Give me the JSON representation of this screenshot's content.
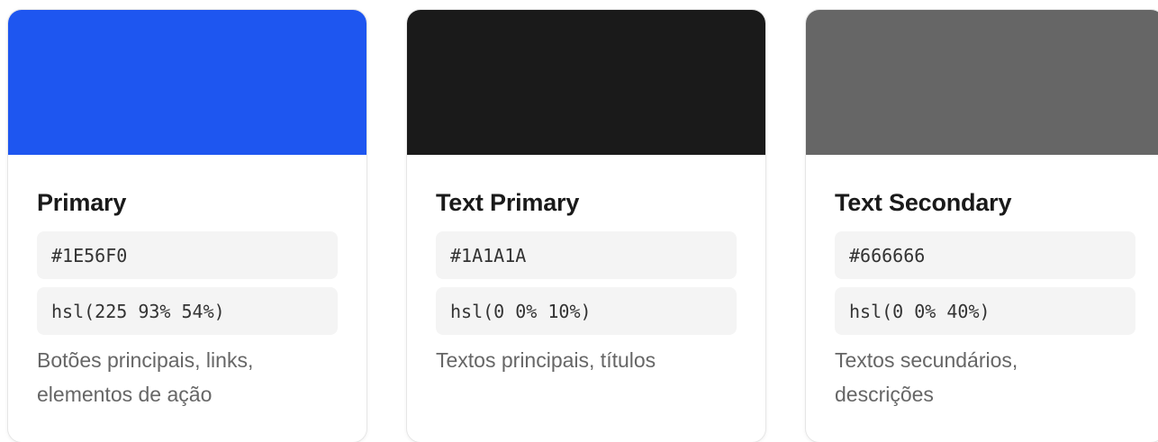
{
  "cards": [
    {
      "name": "Primary",
      "hex": "#1E56F0",
      "hsl": "hsl(225 93% 54%)",
      "usage": "Botões principais, links, elementos de ação",
      "color": "#1E56F0"
    },
    {
      "name": "Text Primary",
      "hex": "#1A1A1A",
      "hsl": "hsl(0 0% 10%)",
      "usage": "Textos principais, títulos",
      "color": "#1A1A1A"
    },
    {
      "name": "Text Secondary",
      "hex": "#666666",
      "hsl": "hsl(0 0% 40%)",
      "usage": "Textos secundários, descrições",
      "color": "#666666"
    }
  ]
}
